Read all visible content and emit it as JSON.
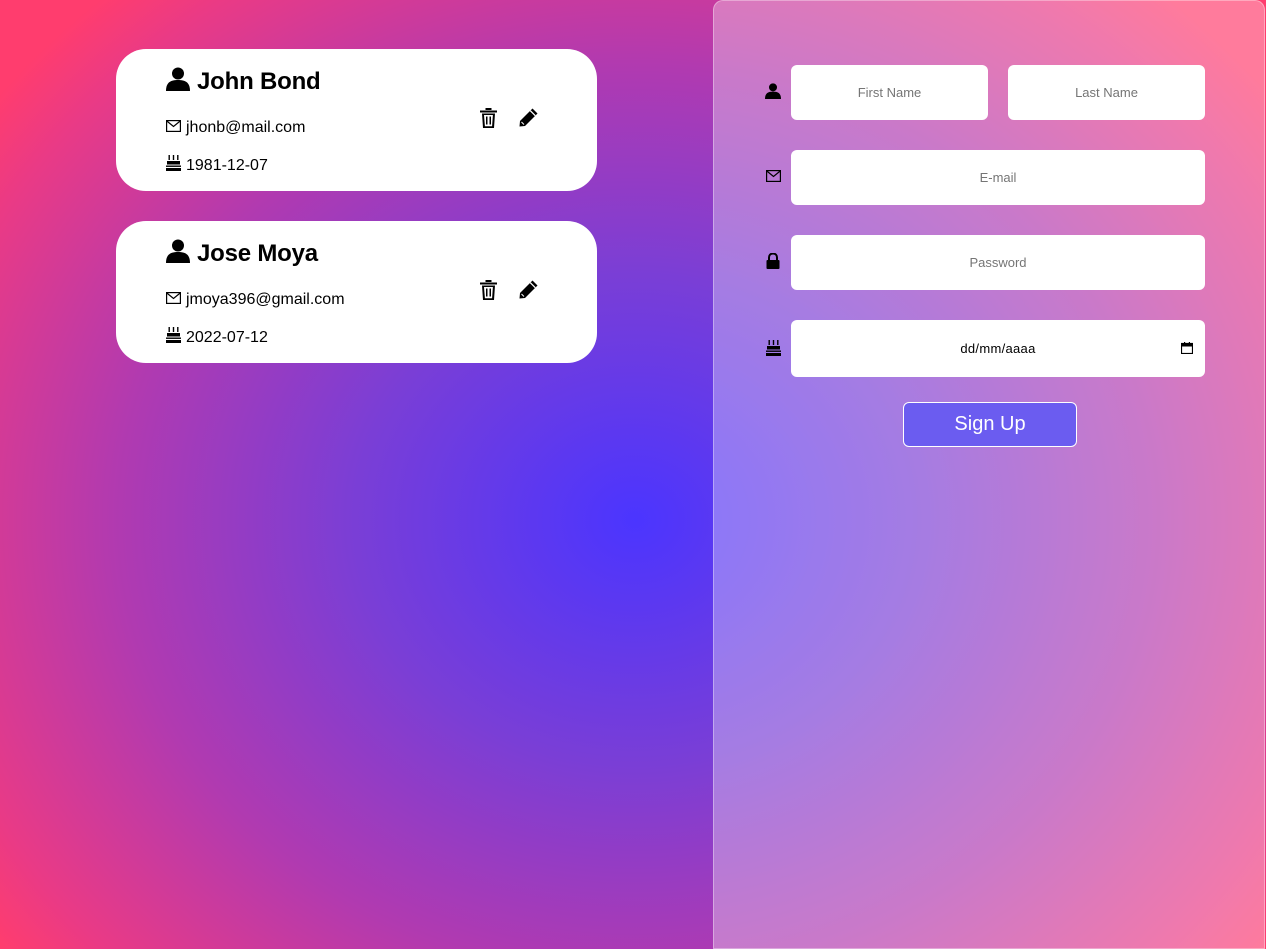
{
  "users": [
    {
      "name": "John Bond",
      "email": "jhonb@mail.com",
      "birthdate": "1981-12-07"
    },
    {
      "name": "Jose Moya",
      "email": "jmoya396@gmail.com",
      "birthdate": "2022-07-12"
    }
  ],
  "form": {
    "first_name_placeholder": "First Name",
    "last_name_placeholder": "Last Name",
    "email_placeholder": "E-mail",
    "password_placeholder": "Password",
    "date_placeholder": "dd/mm/aaaa",
    "submit_label": "Sign Up"
  },
  "colors": {
    "gradient_center": "#4b35ff",
    "gradient_edge": "#ff3d6e",
    "button": "#6b5cf0"
  },
  "icons": {
    "user": "user-icon",
    "email": "envelope-icon",
    "birthday": "cake-icon",
    "password": "lock-icon",
    "delete": "trash-icon",
    "edit": "pencil-icon"
  }
}
